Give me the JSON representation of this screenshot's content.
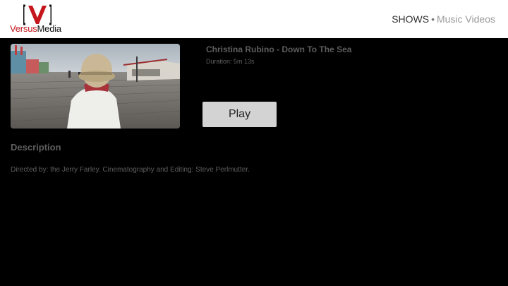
{
  "header": {
    "logo": {
      "mark": "[V]",
      "word_versus": "Versus",
      "word_media": "Media",
      "brand_color": "#c4161c"
    },
    "nav": {
      "items": [
        {
          "label": "SHOWS",
          "active": true
        },
        {
          "label": "Music Videos",
          "active": false
        }
      ],
      "separator": "•"
    }
  },
  "video": {
    "title": "Christina Rubino - Down To The Sea",
    "duration": "Duration: 5m 13s",
    "thumbnail_icon": "video-thumbnail-image"
  },
  "actions": {
    "play_label": "Play"
  },
  "description": {
    "heading": "Description",
    "text": "Directed by: the Jerry Farley. Cinematography and Editing: Steve Perlmutter."
  }
}
